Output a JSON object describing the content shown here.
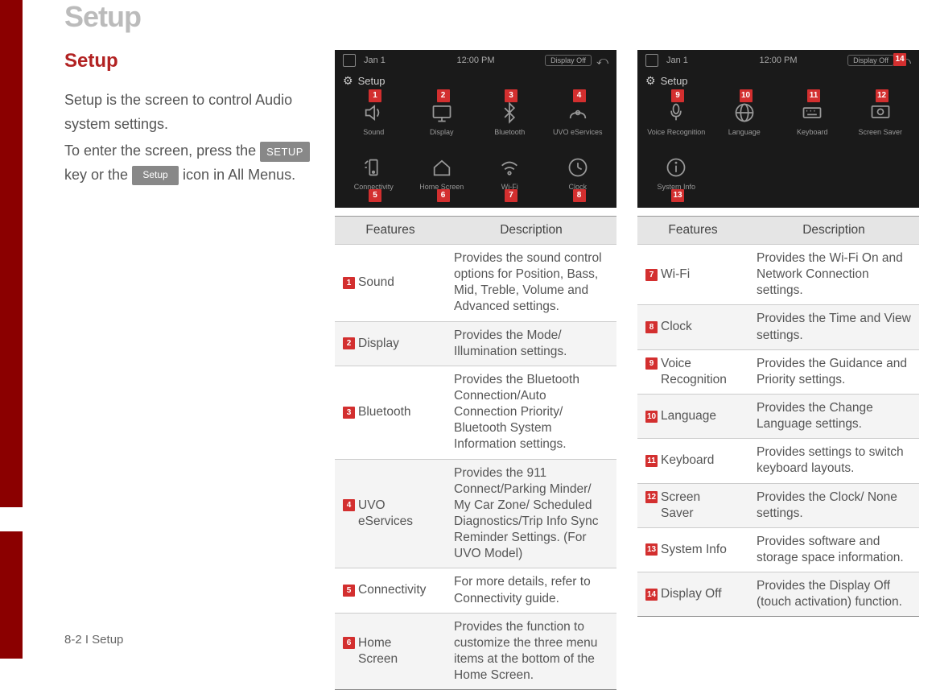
{
  "page_title": "Setup",
  "section_title": "Setup",
  "intro_text_1": "Setup is the screen to control Audio system settings.",
  "intro_text_2a": "To enter the screen, press the ",
  "intro_text_2b": " key or the ",
  "intro_text_2c": " icon in All Menus.",
  "key_setup_upper": "SETUP",
  "key_setup_label": "Setup",
  "status": {
    "date": "Jan 1",
    "time": "12:00 PM",
    "display_off": "Display Off"
  },
  "screen_title": "Setup",
  "grid1": {
    "items": [
      {
        "label": "Sound",
        "marker": "1"
      },
      {
        "label": "Display",
        "marker": "2"
      },
      {
        "label": "Bluetooth",
        "marker": "3"
      },
      {
        "label": "UVO eServices",
        "marker": "4"
      },
      {
        "label": "Connectivity",
        "marker": "5"
      },
      {
        "label": "Home Screen",
        "marker": "6"
      },
      {
        "label": "Wi-Fi",
        "marker": "7"
      },
      {
        "label": "Clock",
        "marker": "8"
      }
    ]
  },
  "grid2": {
    "items": [
      {
        "label": "Voice\nRecognition",
        "marker": "9"
      },
      {
        "label": "Language",
        "marker": "10"
      },
      {
        "label": "Keyboard",
        "marker": "11"
      },
      {
        "label": "Screen Saver",
        "marker": "12"
      },
      {
        "label": "System\nInfo",
        "marker": "13"
      },
      {
        "label": "",
        "marker": ""
      },
      {
        "label": "",
        "marker": ""
      },
      {
        "label": "",
        "marker": ""
      }
    ],
    "top_marker": "14"
  },
  "table_headers": {
    "features": "Features",
    "description": "Description"
  },
  "table1": [
    {
      "num": "1",
      "name": "Sound",
      "desc": "Provides the sound control options for Position, Bass, Mid, Treble, Volume and Advanced settings."
    },
    {
      "num": "2",
      "name": "Display",
      "desc": "Provides the Mode/ Illumination settings."
    },
    {
      "num": "3",
      "name": "Bluetooth",
      "desc": "Provides the Bluetooth Connection/Auto Connection Priority/ Bluetooth System Information settings."
    },
    {
      "num": "4",
      "name": "UVO\neServices",
      "desc": "Provides the 911 Connect/Parking Minder/ My Car Zone/ Scheduled Diagnostics/Trip Info Sync Reminder Settings. (For UVO Model)"
    },
    {
      "num": "5",
      "name": "Connectivity",
      "desc": "For more details, refer to Connectivity guide."
    },
    {
      "num": "6",
      "name": "Home\nScreen",
      "desc": "Provides the function to customize the three menu items at the bottom of the Home Screen."
    }
  ],
  "table2": [
    {
      "num": "7",
      "name": "Wi-Fi",
      "desc": "Provides the Wi-Fi On and Network Connection settings."
    },
    {
      "num": "8",
      "name": "Clock",
      "desc": "Provides the Time and View settings."
    },
    {
      "num": "9",
      "name": "Voice\nRecognition",
      "desc": "Provides the Guidance and Priority settings."
    },
    {
      "num": "10",
      "name": "Language",
      "desc": "Provides the Change Language settings."
    },
    {
      "num": "11",
      "name": "Keyboard",
      "desc": "Provides settings to switch keyboard layouts."
    },
    {
      "num": "12",
      "name": "Screen\nSaver",
      "desc": "Provides the Clock/ None settings."
    },
    {
      "num": "13",
      "name": "System Info",
      "desc": "Provides software and storage space information."
    },
    {
      "num": "14",
      "name": "Display Off",
      "desc": "Provides the Display Off (touch activation) function."
    }
  ],
  "footer": "8-2 I Setup"
}
